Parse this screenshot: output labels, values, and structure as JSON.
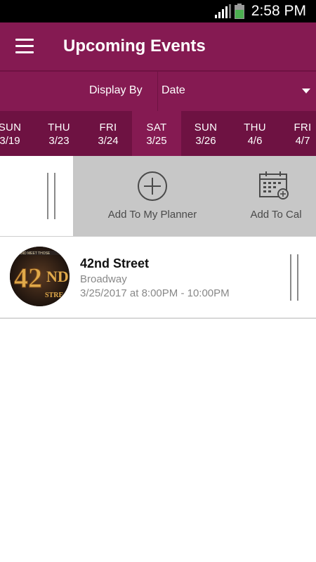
{
  "status_bar": {
    "time": "2:58 PM"
  },
  "app_bar": {
    "title": "Upcoming Events",
    "menu_icon": "hamburger-menu-icon"
  },
  "display_by": {
    "label": "Display By",
    "value": "Date"
  },
  "date_tabs": [
    {
      "day": "SUN",
      "date": "3/19"
    },
    {
      "day": "THU",
      "date": "3/23"
    },
    {
      "day": "FRI",
      "date": "3/24"
    },
    {
      "day": "SAT",
      "date": "3/25",
      "active": true
    },
    {
      "day": "SUN",
      "date": "3/26"
    },
    {
      "day": "THU",
      "date": "4/6"
    },
    {
      "day": "FRI",
      "date": "4/7"
    }
  ],
  "swipe_actions": {
    "add_planner": {
      "label": "Add To My Planner",
      "icon": "plus-circle-icon"
    },
    "add_cal": {
      "label": "Add To Cal",
      "icon": "calendar-add-icon"
    }
  },
  "event": {
    "title": "42nd Street",
    "venue": "Broadway",
    "time": "3/25/2017 at 8:00PM - 10:00PM",
    "thumb_text": "42ND"
  },
  "colors": {
    "primary": "#851a52",
    "primary_dark": "#6e1242",
    "action_bg": "#c7c7c7"
  }
}
